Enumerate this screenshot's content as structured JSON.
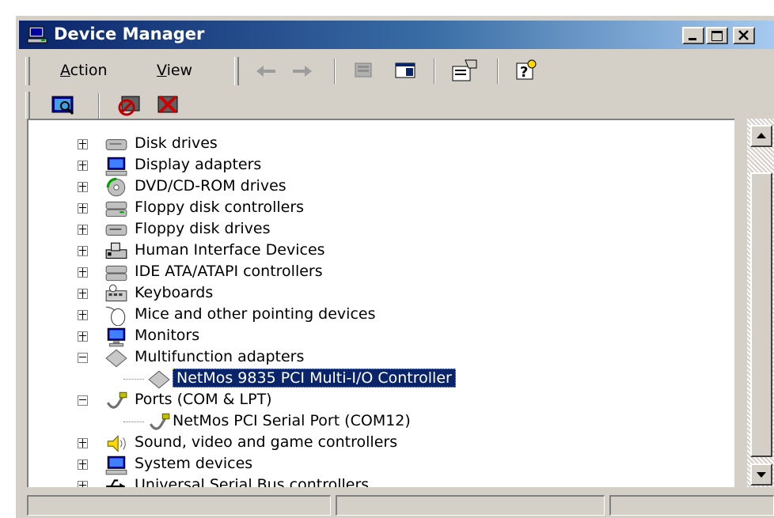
{
  "window": {
    "title": "Device Manager",
    "controls": {
      "minimize": "_",
      "maximize": "□",
      "close": "×"
    }
  },
  "menu": {
    "action": "Action",
    "view": "View"
  },
  "toolbar": {
    "buttons": [
      "back-icon",
      "forward-icon",
      "computer-icon",
      "properties-panel-icon",
      "properties-icon",
      "help-icon"
    ]
  },
  "toolbar2": {
    "buttons": [
      "scan-hardware-icon",
      "disable-device-icon",
      "uninstall-device-icon"
    ]
  },
  "tree": {
    "items": [
      {
        "label": "Disk drives",
        "icon": "disk-drive-icon",
        "level": 0,
        "expander": "plus"
      },
      {
        "label": "Display adapters",
        "icon": "display-adapter-icon",
        "level": 0,
        "expander": "plus"
      },
      {
        "label": "DVD/CD-ROM drives",
        "icon": "dvd-cdrom-icon",
        "level": 0,
        "expander": "plus"
      },
      {
        "label": "Floppy disk controllers",
        "icon": "floppy-controller-icon",
        "level": 0,
        "expander": "plus"
      },
      {
        "label": "Floppy disk drives",
        "icon": "floppy-drive-icon",
        "level": 0,
        "expander": "plus"
      },
      {
        "label": "Human Interface Devices",
        "icon": "hid-icon",
        "level": 0,
        "expander": "plus"
      },
      {
        "label": "IDE ATA/ATAPI controllers",
        "icon": "ide-controller-icon",
        "level": 0,
        "expander": "plus"
      },
      {
        "label": "Keyboards",
        "icon": "keyboard-icon",
        "level": 0,
        "expander": "plus"
      },
      {
        "label": "Mice and other pointing devices",
        "icon": "mouse-icon",
        "level": 0,
        "expander": "plus"
      },
      {
        "label": "Monitors",
        "icon": "monitor-icon",
        "level": 0,
        "expander": "plus"
      },
      {
        "label": "Multifunction adapters",
        "icon": "multifunction-icon",
        "level": 0,
        "expander": "minus"
      },
      {
        "label": "NetMos 9835 PCI Multi-I/O Controller",
        "icon": "multifunction-icon",
        "level": 1,
        "expander": "none",
        "selected": true
      },
      {
        "label": "Ports (COM & LPT)",
        "icon": "port-icon",
        "level": 0,
        "expander": "minus"
      },
      {
        "label": "NetMos PCI Serial Port (COM12)",
        "icon": "port-icon",
        "level": 1,
        "expander": "none"
      },
      {
        "label": "Sound, video and game controllers",
        "icon": "sound-icon",
        "level": 0,
        "expander": "plus"
      },
      {
        "label": "System devices",
        "icon": "system-device-icon",
        "level": 0,
        "expander": "plus"
      },
      {
        "label": "Universal Serial Bus controllers",
        "icon": "usb-icon",
        "level": 0,
        "expander": "plus"
      }
    ]
  },
  "colors": {
    "selection": "#0a246a",
    "chrome": "#d4d0c8",
    "titlebar_start": "#0a246a",
    "titlebar_end": "#a6caf0"
  }
}
